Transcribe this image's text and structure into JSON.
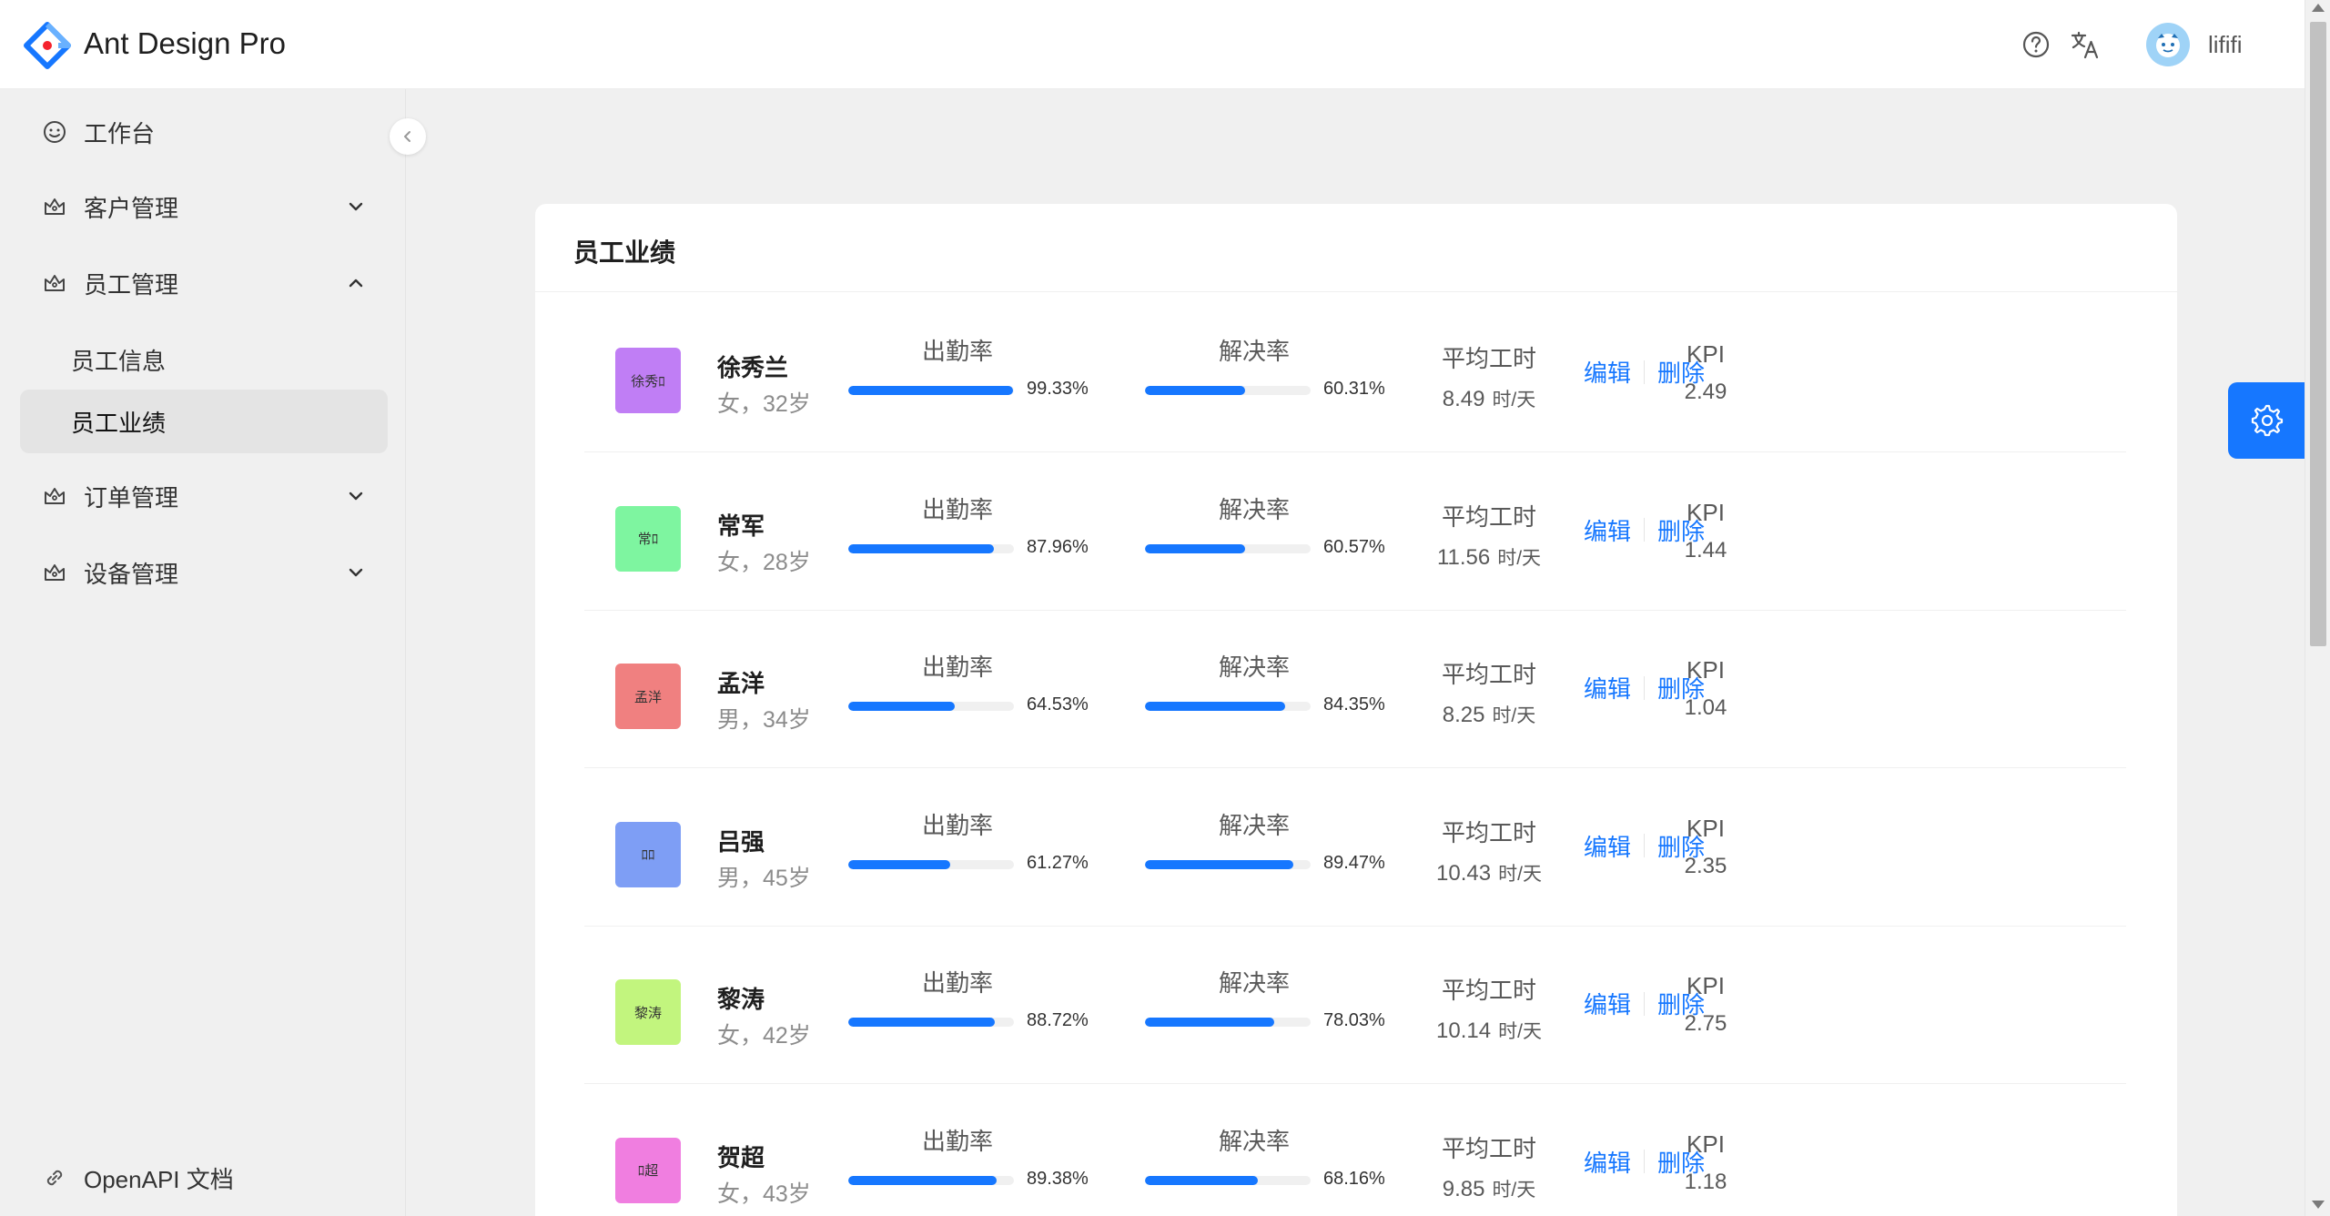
{
  "app": {
    "title": "Ant Design Pro"
  },
  "header": {
    "username": "lififi"
  },
  "sidebar": {
    "items": [
      {
        "label": "工作台",
        "icon": "smile-icon"
      },
      {
        "label": "客户管理",
        "icon": "crown-icon",
        "expandable": true,
        "expanded": false
      },
      {
        "label": "员工管理",
        "icon": "crown-icon",
        "expandable": true,
        "expanded": true,
        "children": [
          {
            "label": "员工信息",
            "active": false
          },
          {
            "label": "员工业绩",
            "active": true
          }
        ]
      },
      {
        "label": "订单管理",
        "icon": "crown-icon",
        "expandable": true,
        "expanded": false
      },
      {
        "label": "设备管理",
        "icon": "crown-icon",
        "expandable": true,
        "expanded": false
      }
    ],
    "footer_link": "OpenAPI 文档"
  },
  "card": {
    "title": "员工业绩",
    "labels": {
      "attendance": "出勤率",
      "resolution": "解决率",
      "avg_hours": "平均工时",
      "hours_unit": "时/天",
      "kpi": "KPI",
      "edit": "编辑",
      "delete": "删除"
    },
    "employees": [
      {
        "name": "徐秀兰",
        "desc": "女，32岁",
        "avatar_text": "徐秀ﾛ",
        "avatar_color": "#c07ef5",
        "attendance": "99.33%",
        "attendance_value": 99.33,
        "resolution": "60.31%",
        "resolution_value": 60.31,
        "avg_hours": "8.49",
        "kpi": "2.49"
      },
      {
        "name": "常军",
        "desc": "女，28岁",
        "avatar_text": "常ﾛ",
        "avatar_color": "#7ef5a0",
        "attendance": "87.96%",
        "attendance_value": 87.96,
        "resolution": "60.57%",
        "resolution_value": 60.57,
        "avg_hours": "11.56",
        "kpi": "1.44"
      },
      {
        "name": "孟洋",
        "desc": "男，34岁",
        "avatar_text": "孟洋",
        "avatar_color": "#f08080",
        "attendance": "64.53%",
        "attendance_value": 64.53,
        "resolution": "84.35%",
        "resolution_value": 84.35,
        "avg_hours": "8.25",
        "kpi": "1.04"
      },
      {
        "name": "吕强",
        "desc": "男，45岁",
        "avatar_text": "ﾛﾛ",
        "avatar_color": "#7e9ef5",
        "attendance": "61.27%",
        "attendance_value": 61.27,
        "resolution": "89.47%",
        "resolution_value": 89.47,
        "avg_hours": "10.43",
        "kpi": "2.35"
      },
      {
        "name": "黎涛",
        "desc": "女，42岁",
        "avatar_text": "黎涛",
        "avatar_color": "#c2f57e",
        "attendance": "88.72%",
        "attendance_value": 88.72,
        "resolution": "78.03%",
        "resolution_value": 78.03,
        "avg_hours": "10.14",
        "kpi": "2.75"
      },
      {
        "name": "贺超",
        "desc": "女，43岁",
        "avatar_text": "ﾛ超",
        "avatar_color": "#f07ee0",
        "attendance": "89.38%",
        "attendance_value": 89.38,
        "resolution": "68.16%",
        "resolution_value": 68.16,
        "avg_hours": "9.85",
        "kpi": "1.18"
      }
    ]
  },
  "colors": {
    "primary": "#1677ff",
    "track": "#f0f0f0",
    "active_menu_bg": "#e4e4e4"
  }
}
